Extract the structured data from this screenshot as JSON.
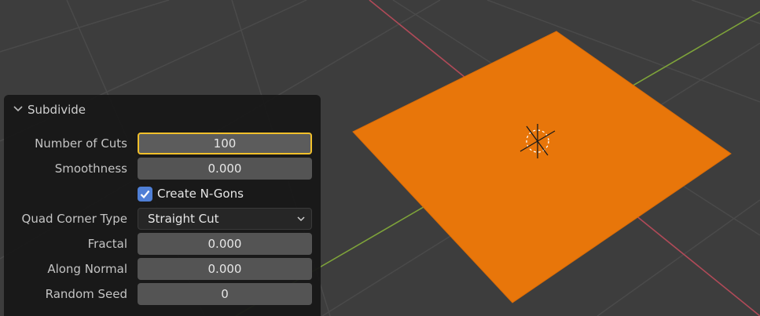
{
  "viewport": {
    "background_color": "#3d3d3d",
    "grid_color": "#4a4a4a",
    "x_axis_color": "#b04a58",
    "y_axis_color": "#7ea33a",
    "object_color": "#e8760a",
    "origin_icon": "object-origin-icon"
  },
  "panel": {
    "title": "Subdivide",
    "collapse_icon": "chevron-down-icon",
    "number_of_cuts": {
      "label": "Number of Cuts",
      "value": "100"
    },
    "smoothness": {
      "label": "Smoothness",
      "value": "0.000"
    },
    "create_ngons": {
      "label": "Create N-Gons",
      "checked": true
    },
    "quad_corner_type": {
      "label": "Quad Corner Type",
      "value": "Straight Cut"
    },
    "fractal": {
      "label": "Fractal",
      "value": "0.000"
    },
    "along_normal": {
      "label": "Along Normal",
      "value": "0.000"
    },
    "random_seed": {
      "label": "Random Seed",
      "value": "0"
    },
    "accent_color": "#f2c02b",
    "checkbox_color": "#4f7fd6"
  }
}
